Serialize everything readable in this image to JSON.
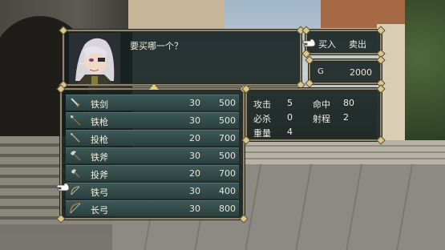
{
  "dialog": {
    "text": "要买哪一个？"
  },
  "commands": {
    "buy": "买入",
    "sell": "卖出"
  },
  "gold": {
    "label": "G",
    "value": "2000"
  },
  "items": [
    {
      "name": "铁剑",
      "uses": "30",
      "price": "500",
      "icon": "sword-icon"
    },
    {
      "name": "铁枪",
      "uses": "30",
      "price": "500",
      "icon": "lance-icon"
    },
    {
      "name": "投枪",
      "uses": "20",
      "price": "700",
      "icon": "javelin-icon"
    },
    {
      "name": "铁斧",
      "uses": "30",
      "price": "500",
      "icon": "axe-icon"
    },
    {
      "name": "投斧",
      "uses": "20",
      "price": "700",
      "icon": "hand-axe-icon"
    },
    {
      "name": "铁弓",
      "uses": "30",
      "price": "400",
      "icon": "bow-icon"
    },
    {
      "name": "长弓",
      "uses": "30",
      "price": "800",
      "icon": "longbow-icon"
    }
  ],
  "stats": {
    "attack_label": "攻击",
    "attack": "5",
    "hit_label": "命中",
    "hit": "80",
    "crit_label": "必杀",
    "crit": "0",
    "range_label": "射程",
    "range": "2",
    "weight_label": "重量",
    "weight": "4"
  },
  "colors": {
    "panel": "#121e1c",
    "border": "#8d856c",
    "accent": "#e6cf7a",
    "row": "#3d5856"
  }
}
